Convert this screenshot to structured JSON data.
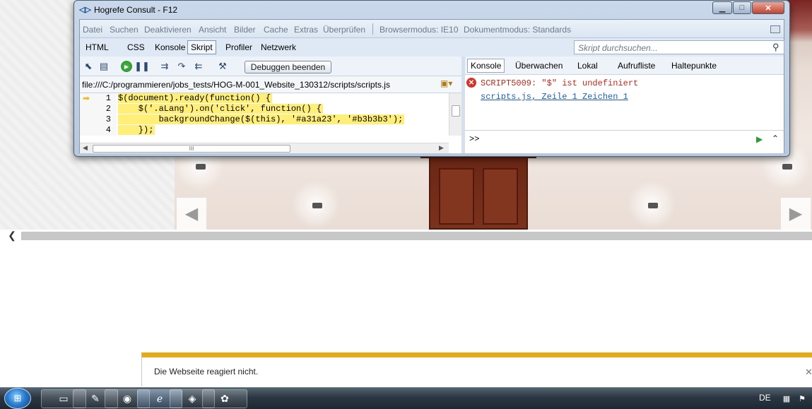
{
  "window": {
    "title": "Hogrefe Consult - F12",
    "min_glyph": "▁",
    "max_glyph": "□",
    "close_glyph": "✕"
  },
  "menu": {
    "items": [
      "Datei",
      "Suchen",
      "Deaktivieren",
      "Ansicht",
      "Bilder",
      "Cache",
      "Extras",
      "Überprüfen"
    ],
    "browser_mode": "Browsermodus: IE10",
    "document_mode": "Dokumentmodus: Standards"
  },
  "tabs": {
    "items": [
      "HTML",
      "CSS",
      "Konsole",
      "Skript",
      "Profiler",
      "Netzwerk"
    ],
    "active": "Skript"
  },
  "search": {
    "placeholder": "Skript durchsuchen..."
  },
  "toolbar": {
    "stop_debug_label": "Debuggen beenden"
  },
  "script": {
    "file_path": "file:///C:/programmieren/jobs_tests/HOG-M-001_Website_130312/scripts/scripts.js",
    "lines": [
      {
        "num": "1",
        "code": "$(document).ready(function() {"
      },
      {
        "num": "2",
        "code": "    $('.aLang').on('click', function() {"
      },
      {
        "num": "3",
        "code": "        backgroundChange($(this), '#a31a23', '#b3b3b3');"
      },
      {
        "num": "4",
        "code": "    });"
      }
    ],
    "hscroll_grip": "III"
  },
  "right_tabs": {
    "items": [
      "Konsole",
      "Überwachen",
      "Lokal",
      "Aufrufliste",
      "Haltepunkte"
    ],
    "active": "Konsole"
  },
  "console": {
    "error_message": "SCRIPT5009: \"$\" ist undefiniert",
    "error_link": "scripts.js, Zeile 1 Zeichen 1",
    "prompt": ">>"
  },
  "notification": {
    "message": "Die Webseite reagiert nicht."
  },
  "taskbar": {
    "language": "DE"
  },
  "colors": {
    "error": "#c0281c",
    "link": "#1d5fb8",
    "code_highlight": "#ffef78",
    "notification_bar": "#e6a918"
  },
  "icons": [
    "ie-icon",
    "pointer-icon",
    "break-icon",
    "play-icon",
    "pause-icon",
    "step-into-icon",
    "step-over-icon",
    "step-out-icon",
    "settings-icon",
    "document-select-icon",
    "search-icon",
    "error-icon",
    "run-icon",
    "expand-icon",
    "start-icon",
    "explorer-icon",
    "notes-icon",
    "firefox-icon",
    "ie-taskbar-icon",
    "app-icon",
    "paint-icon",
    "network-icon",
    "flag-icon"
  ]
}
